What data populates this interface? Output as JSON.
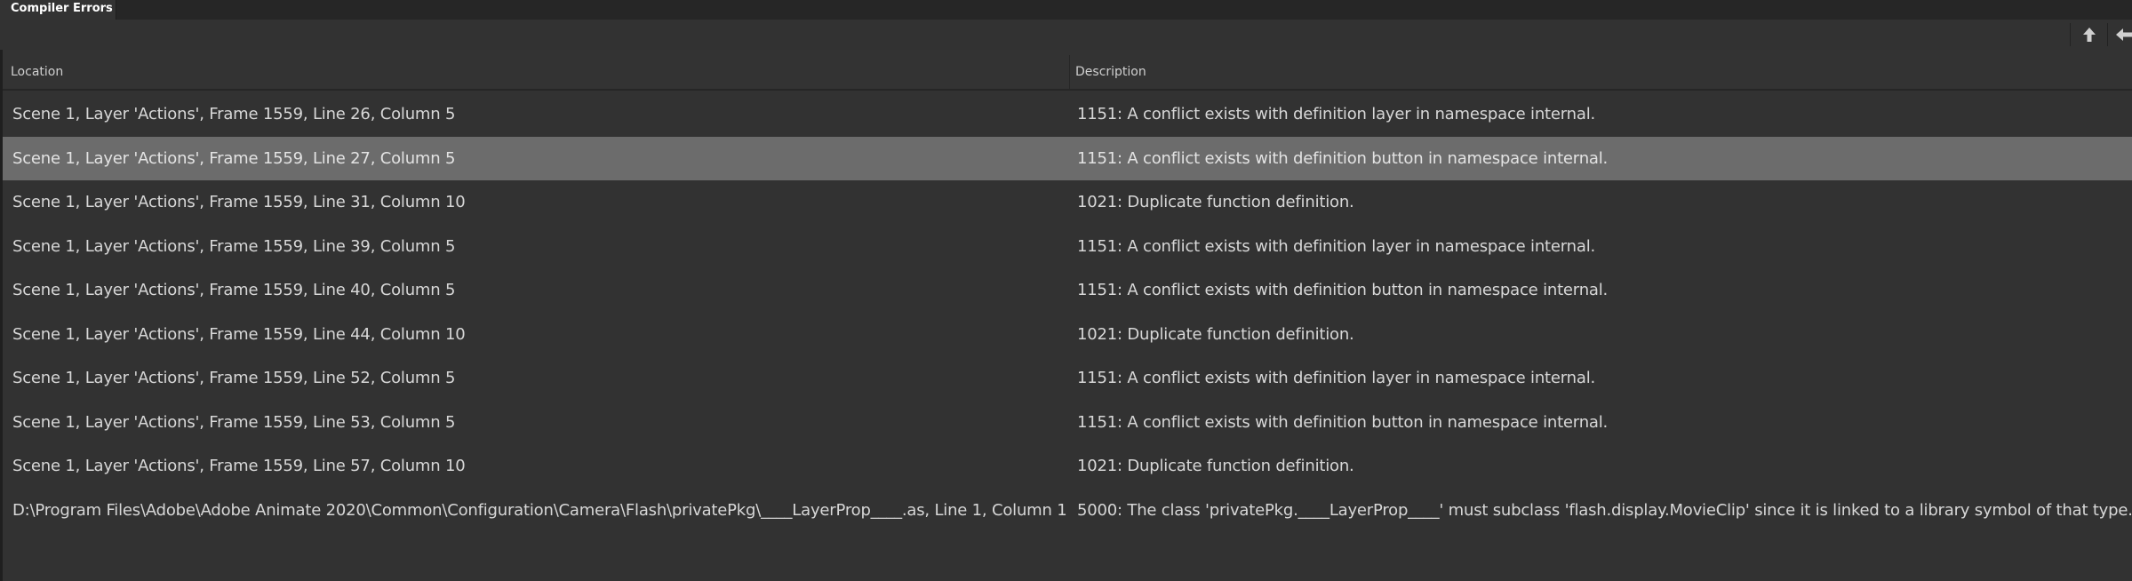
{
  "panel": {
    "tab_label": "Compiler Errors"
  },
  "toolbar": {
    "icons": [
      "arrow-up-icon",
      "arrow-left-icon"
    ]
  },
  "table": {
    "columns": {
      "location": "Location",
      "description": "Description"
    },
    "selected_row": 1,
    "rows": [
      {
        "location": "Scene 1, Layer 'Actions', Frame 1559, Line 26, Column 5",
        "description": "1151: A conflict exists with definition layer in namespace internal."
      },
      {
        "location": "Scene 1, Layer 'Actions', Frame 1559, Line 27, Column 5",
        "description": "1151: A conflict exists with definition button in namespace internal."
      },
      {
        "location": "Scene 1, Layer 'Actions', Frame 1559, Line 31, Column 10",
        "description": "1021: Duplicate function definition."
      },
      {
        "location": "Scene 1, Layer 'Actions', Frame 1559, Line 39, Column 5",
        "description": "1151: A conflict exists with definition layer in namespace internal."
      },
      {
        "location": "Scene 1, Layer 'Actions', Frame 1559, Line 40, Column 5",
        "description": "1151: A conflict exists with definition button in namespace internal."
      },
      {
        "location": "Scene 1, Layer 'Actions', Frame 1559, Line 44, Column 10",
        "description": "1021: Duplicate function definition."
      },
      {
        "location": "Scene 1, Layer 'Actions', Frame 1559, Line 52, Column 5",
        "description": "1151: A conflict exists with definition layer in namespace internal."
      },
      {
        "location": "Scene 1, Layer 'Actions', Frame 1559, Line 53, Column 5",
        "description": "1151: A conflict exists with definition button in namespace internal."
      },
      {
        "location": "Scene 1, Layer 'Actions', Frame 1559, Line 57, Column 10",
        "description": "1021: Duplicate function definition."
      },
      {
        "location": "D:\\Program Files\\Adobe\\Adobe Animate 2020\\Common\\Configuration\\Camera\\Flash\\privatePkg\\____LayerProp____.as, Line 1, Column 1",
        "description": "5000: The class 'privatePkg.____LayerProp____' must subclass 'flash.display.MovieClip' since it is linked to a library symbol of that type."
      }
    ]
  },
  "colors": {
    "background": "#323232",
    "selected_row": "#6c6c6c",
    "tab_bar": "#262626",
    "text": "#d7d7d7"
  }
}
